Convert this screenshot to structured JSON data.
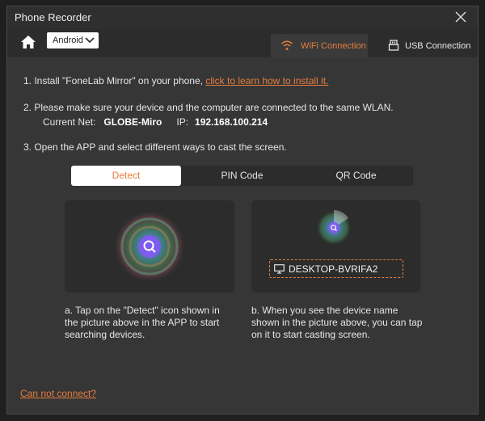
{
  "window": {
    "title": "Phone Recorder"
  },
  "toolbar": {
    "platform_selected": "Android",
    "tabs": [
      {
        "label": "WiFi Connection",
        "icon": "wifi-icon",
        "active": true
      },
      {
        "label": "USB Connection",
        "icon": "usb-icon",
        "active": false
      }
    ]
  },
  "steps": {
    "step1_text": "1. Install \"FoneLab Mirror\" on your phone, ",
    "step1_link": "click to learn how to install it.",
    "step2_text": "2. Please make sure your device and the computer are connected to the same WLAN.",
    "current_net_label": "Current Net:",
    "current_net_value": "GLOBE-Miro",
    "ip_label": "IP:",
    "ip_value": "192.168.100.214",
    "step3_text": "3. Open the APP and select different ways to cast the screen."
  },
  "methods": {
    "tabs": [
      {
        "label": "Detect",
        "active": true
      },
      {
        "label": "PIN Code",
        "active": false
      },
      {
        "label": "QR Code",
        "active": false
      }
    ]
  },
  "panels": {
    "device_name": "DESKTOP-BVRIFA2",
    "caption_left": "a. Tap on the \"Detect\" icon shown in the picture above in the APP to start searching devices.",
    "caption_right": "b. When you see the device name shown in the picture above, you can tap on it to start casting screen."
  },
  "footer": {
    "cannot_connect": "Can not connect?"
  },
  "colors": {
    "accent": "#e87d3e",
    "background": "#363636",
    "panel": "#2c2c2c"
  }
}
